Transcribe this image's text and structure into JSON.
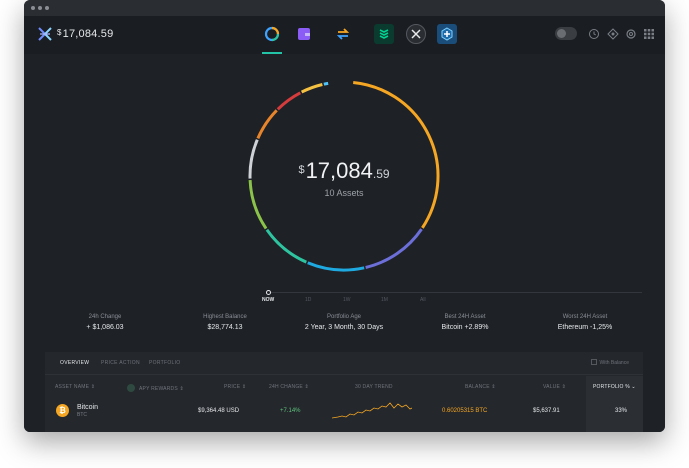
{
  "topbar": {
    "total_currency": "$",
    "total_value": "17,084.59",
    "nav_icons": [
      "portfolio-icon",
      "wallet-icon",
      "exchange-icon",
      "compound-icon",
      "xrp-icon",
      "plus-app-icon"
    ],
    "right_icons": [
      "toggle-switch",
      "history-icon",
      "backup-icon",
      "settings-icon",
      "apps-grid-icon"
    ]
  },
  "colors": {
    "accent": "#22c3a6",
    "btc": "#f5a623",
    "green": "#5ec27d"
  },
  "donut": {
    "currency": "$",
    "amount_int": "17,084",
    "amount_dec": ".59",
    "assets_label": "10 Assets",
    "segments": [
      {
        "color": "#f5a623",
        "fraction": 0.33
      },
      {
        "color": "#6c6fd8",
        "fraction": 0.12
      },
      {
        "color": "#1ea9e1",
        "fraction": 0.1
      },
      {
        "color": "#2ec4a0",
        "fraction": 0.09
      },
      {
        "color": "#8bc34a",
        "fraction": 0.09
      },
      {
        "color": "#cfd2d6",
        "fraction": 0.07
      },
      {
        "color": "#e8852b",
        "fraction": 0.06
      },
      {
        "color": "#d63c3c",
        "fraction": 0.05
      },
      {
        "color": "#f5c142",
        "fraction": 0.04
      },
      {
        "color": "#4fc3f7",
        "fraction": 0.01
      }
    ]
  },
  "timeline": {
    "labels": [
      "NOW",
      "1D",
      "1W",
      "1M",
      "All"
    ]
  },
  "stats": [
    {
      "label": "24h Change",
      "value": "+ $1,086.03"
    },
    {
      "label": "Highest Balance",
      "value": "$28,774.13"
    },
    {
      "label": "Portfolio Age",
      "value": "2 Year, 3 Month, 30 Days"
    },
    {
      "label": "Best 24H Asset",
      "value": "Bitcoin +2.89%"
    },
    {
      "label": "Worst 24H Asset",
      "value": "Ethereum -1,25%"
    }
  ],
  "table": {
    "tabs": [
      "OVERVIEW",
      "PRICE ACTION",
      "PORTFOLIO"
    ],
    "with_balance": "With Balance",
    "headers": {
      "asset_name": "ASSET NAME",
      "apy": "APY REWARDS",
      "price": "PRICE",
      "change": "24H CHANGE",
      "trend": "30 DAY TREND",
      "balance": "BALANCE",
      "value": "VALUE",
      "portfolio": "PORTFOLIO %"
    },
    "rows": [
      {
        "icon": "bitcoin-icon",
        "name": "Bitcoin",
        "symbol": "BTC",
        "price": "$9,364.48 USD",
        "change": "+7.14%",
        "balance": "0.60205315 BTC",
        "value": "$5,637.91",
        "portfolio": "33%"
      }
    ]
  }
}
